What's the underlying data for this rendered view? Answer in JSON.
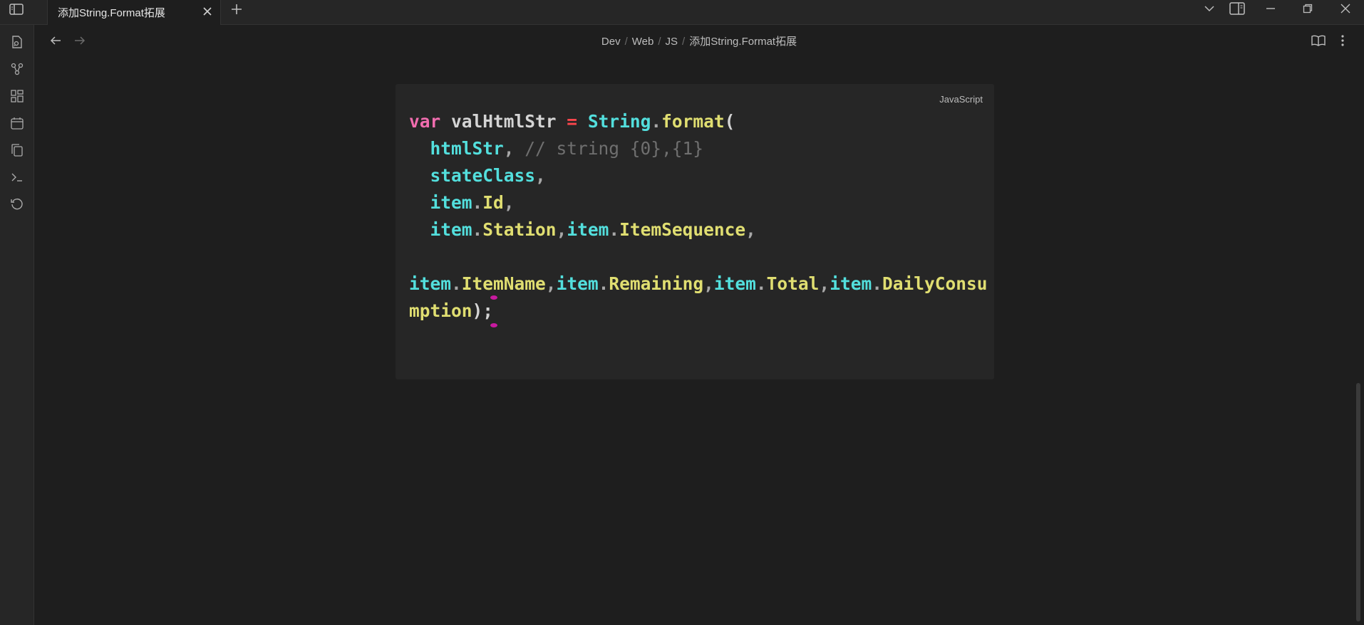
{
  "tabs": [
    {
      "title": "添加String.Format拓展"
    }
  ],
  "breadcrumb": [
    "Dev",
    "Web",
    "JS",
    "添加String.Format拓展"
  ],
  "codeblock": {
    "language": "JavaScript",
    "tokens": {
      "l1_var": "var",
      "l1_name": " valHtmlStr ",
      "l1_eq": "=",
      "l1_sp": " ",
      "l1_cls": "String",
      "l1_dot": ".",
      "l1_fn": "format",
      "l1_paren": "(",
      "l2_indent": "  ",
      "l2_arg": "htmlStr",
      "l2_comma": ", ",
      "l2_comment": "// string {0},{1}",
      "l3_indent": "  ",
      "l3_arg": "stateClass",
      "l3_comma": ",",
      "l4_indent": "  ",
      "l4_obj": "item",
      "l4_dot": ".",
      "l4_prop": "Id",
      "l4_comma": ",",
      "l5_indent": "  ",
      "l5_obj1": "item",
      "l5_dot1": ".",
      "l5_prop1": "Station",
      "l5_c1": ",",
      "l5_obj2": "item",
      "l5_dot2": ".",
      "l5_prop2": "ItemSequence",
      "l5_c2": ",",
      "l7_obj1": "item",
      "l7_dot1": ".",
      "l7_prop1": "ItemName",
      "l7_c1": ",",
      "l7_obj2": "item",
      "l7_dot2": ".",
      "l7_prop2": "Remaining",
      "l7_c2": ",",
      "l7_obj3": "item",
      "l7_dot3": ".",
      "l7_prop3": "Total",
      "l7_c3": ",",
      "l7_obj4": "item",
      "l7_dot4": ".",
      "l7_prop4": "DailyConsu",
      "l8_prop": "mption",
      "l8_end": ");"
    }
  },
  "colors": {
    "background": "#1e1e1e",
    "code_background": "#262626",
    "keyword": "#f16daf",
    "operator": "#fb464c",
    "class": "#53dfdd",
    "property": "#e0de71",
    "comment": "#6f6f6f",
    "marker": "#c81aa0"
  },
  "icons": {
    "sidebar_toggle": "sidebar-left-icon",
    "tab_close": "close-icon",
    "new_tab": "plus-icon",
    "tab_list": "chevron-down-icon",
    "right_sidebar": "sidebar-right-icon",
    "minimize": "minimize-icon",
    "restore": "restore-icon",
    "close_window": "close-icon",
    "ribbon": [
      "file-search-icon",
      "graph-icon",
      "canvas-icon",
      "calendar-icon",
      "copy-icon",
      "terminal-icon",
      "history-icon"
    ],
    "back": "arrow-left-icon",
    "forward": "arrow-right-icon",
    "reading_view": "book-open-icon",
    "more_options": "more-vertical-icon"
  }
}
